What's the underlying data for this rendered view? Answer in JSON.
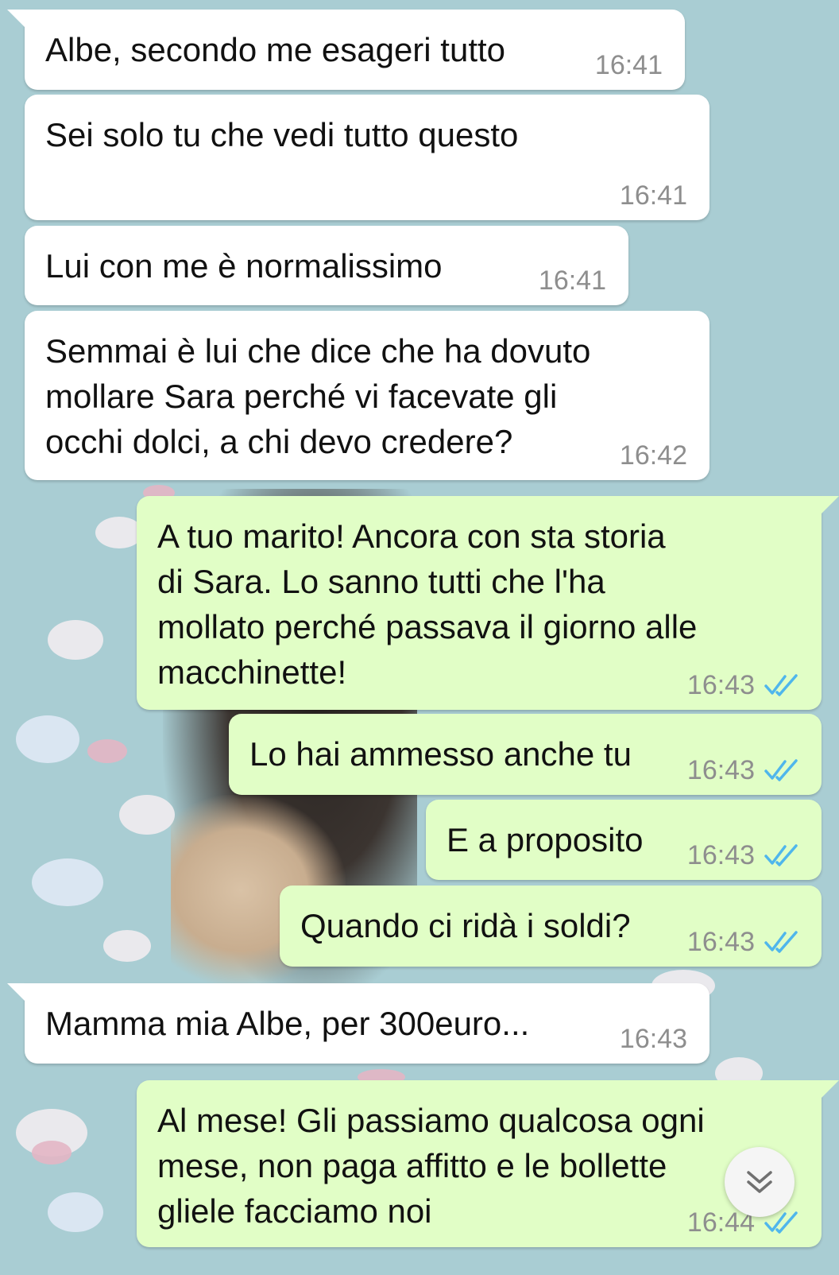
{
  "colors": {
    "wallpaper": "#a9cdd3",
    "incoming_bubble": "#ffffff",
    "outgoing_bubble": "#e1fec6",
    "timestamp": "#8e8e8e",
    "read_ticks": "#4fb6ec"
  },
  "messages": [
    {
      "direction": "incoming",
      "text": "Albe, secondo me esageri tutto",
      "time": "16:41"
    },
    {
      "direction": "incoming",
      "text": "Sei solo tu che vedi tutto questo",
      "time": "16:41"
    },
    {
      "direction": "incoming",
      "text": "Lui con me è normalissimo",
      "time": "16:41"
    },
    {
      "direction": "incoming",
      "text": "Semmai è lui che dice che ha dovuto\nmollare Sara perché vi facevate gli\nocchi dolci, a chi devo credere?",
      "time": "16:42"
    },
    {
      "direction": "outgoing",
      "text": "A tuo marito! Ancora con sta storia\ndi Sara. Lo sanno tutti che l'ha\nmollato perché passava il giorno alle\nmacchinette!",
      "time": "16:43",
      "status": "read"
    },
    {
      "direction": "outgoing",
      "text": "Lo hai ammesso anche tu",
      "time": "16:43",
      "status": "read"
    },
    {
      "direction": "outgoing",
      "text": "E a proposito",
      "time": "16:43",
      "status": "read"
    },
    {
      "direction": "outgoing",
      "text": "Quando ci ridà i soldi?",
      "time": "16:43",
      "status": "read"
    },
    {
      "direction": "incoming",
      "text": "Mamma mia Albe, per 300euro...",
      "time": "16:43"
    },
    {
      "direction": "outgoing",
      "text": "Al mese! Gli passiamo qualcosa ogni\nmese, non paga affitto e le bollette\ngliele facciamo noi",
      "time": "16:44",
      "status": "read"
    }
  ],
  "scroll_button": {
    "icon": "double-chevron-down-icon"
  }
}
